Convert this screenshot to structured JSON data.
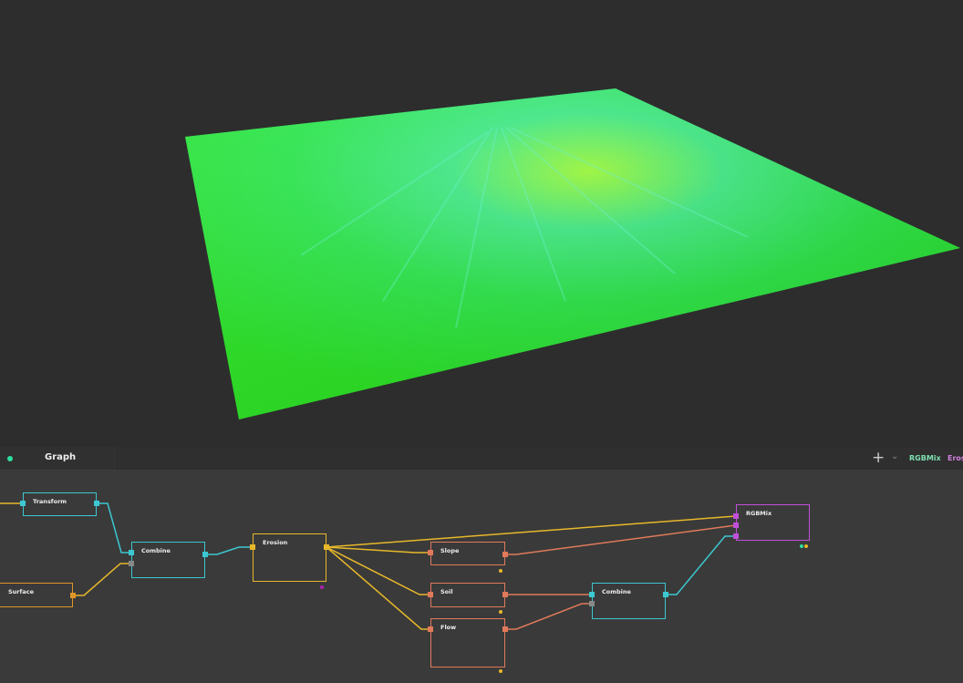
{
  "viewport": {
    "terrain_colors": [
      "#20e020",
      "#40f0c0",
      "#50ff30"
    ]
  },
  "panel": {
    "tab_label": "Graph",
    "status_color": "#2ee0a0",
    "add_icon": "plus-icon",
    "dropdown_icon": "chevron-down-icon",
    "breadcrumbs": [
      {
        "label": "RGBMix",
        "color": "#7ee0b0"
      },
      {
        "label": "Eros",
        "color": "#d080e0"
      }
    ]
  },
  "nodes": {
    "transform": {
      "label": "Transform",
      "color": "#3cc8d0"
    },
    "surface": {
      "label": "Surface",
      "color": "#e0952a"
    },
    "combine1": {
      "label": "Combine",
      "color": "#3cc8d0"
    },
    "erosion": {
      "label": "Erosion",
      "color": "#e8b82a"
    },
    "slope": {
      "label": "Slope",
      "color": "#e07a5a"
    },
    "soil": {
      "label": "Soil",
      "color": "#e07a5a"
    },
    "flow": {
      "label": "Flow",
      "color": "#e07a5a"
    },
    "combine2": {
      "label": "Combine",
      "color": "#3cc8d0"
    },
    "rgbmix": {
      "label": "RGBMix",
      "color": "#c050d8"
    }
  }
}
